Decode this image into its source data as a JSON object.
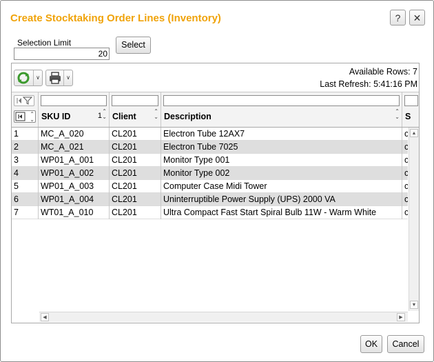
{
  "dialog": {
    "title": "Create Stocktaking Order Lines (Inventory)",
    "help_label": "?",
    "close_label": "✕",
    "accent_color": "#f0a30a"
  },
  "selection": {
    "label": "Selection Limit",
    "value": "20",
    "select_button": "Select"
  },
  "toolbar": {
    "refresh_icon": "refresh-icon",
    "print_icon": "print-icon",
    "dropdown_icon": "chevron-down-icon",
    "available_rows": "Available Rows: 7",
    "last_refresh": "Last Refresh: 5:41:16 PM"
  },
  "table": {
    "columns": {
      "sku": "SKU ID",
      "sku_sort": "1",
      "client": "Client",
      "description": "Description",
      "next": "S"
    },
    "rows": [
      {
        "n": "1",
        "sku": "MC_A_020",
        "client": "CL201",
        "desc": "Electron Tube 12AX7",
        "next": "c"
      },
      {
        "n": "2",
        "sku": "MC_A_021",
        "client": "CL201",
        "desc": "Electron Tube 7025",
        "next": "c"
      },
      {
        "n": "3",
        "sku": "WP01_A_001",
        "client": "CL201",
        "desc": "Monitor Type 001",
        "next": "c"
      },
      {
        "n": "4",
        "sku": "WP01_A_002",
        "client": "CL201",
        "desc": "Monitor Type 002",
        "next": "c"
      },
      {
        "n": "5",
        "sku": "WP01_A_003",
        "client": "CL201",
        "desc": "Computer Case Midi Tower",
        "next": "c"
      },
      {
        "n": "6",
        "sku": "WP01_A_004",
        "client": "CL201",
        "desc": "Uninterruptible Power Supply (UPS) 2000 VA",
        "next": "c"
      },
      {
        "n": "7",
        "sku": "WT01_A_010",
        "client": "CL201",
        "desc": "Ultra Compact Fast Start Spiral Bulb 11W - Warm White",
        "next": "c"
      }
    ]
  },
  "footer": {
    "ok": "OK",
    "cancel": "Cancel"
  }
}
